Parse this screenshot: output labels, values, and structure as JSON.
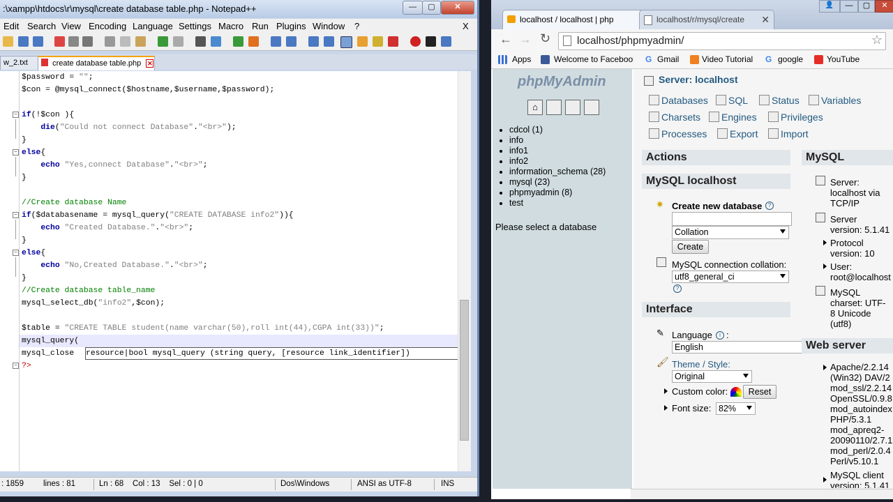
{
  "notepad": {
    "title": ":\\xampp\\htdocs\\r\\mysql\\create database table.php - Notepad++",
    "menu": [
      "Edit",
      "Search",
      "View",
      "Encoding",
      "Language",
      "Settings",
      "Macro",
      "Run",
      "Plugins",
      "Window",
      "?"
    ],
    "menu_close": "X",
    "tabs": [
      {
        "label": "w_2.txt"
      },
      {
        "label": "create database table.php"
      }
    ],
    "code_lines": [
      {
        "text": "$password = \"\";"
      },
      {
        "text": "$con = @mysql_connect($hostname,$username,$password);"
      },
      {
        "text": ""
      },
      {
        "text": "if(!$con ){"
      },
      {
        "text": "    die(\"Could not connect Database\".\"<br>\");"
      },
      {
        "text": "}"
      },
      {
        "text": "else{"
      },
      {
        "text": "    echo \"Yes,connect Database\".\"<br>\";"
      },
      {
        "text": "}"
      },
      {
        "text": ""
      },
      {
        "text": "//Create database Name"
      },
      {
        "text": "if($databasename = mysql_query(\"CREATE DATABASE info2\")){"
      },
      {
        "text": "    echo \"Created Database.\".\"<br>\";"
      },
      {
        "text": "}"
      },
      {
        "text": "else{"
      },
      {
        "text": "    echo \"No,Created Database.\".\"<br>\";"
      },
      {
        "text": "}"
      },
      {
        "text": "//Create database table_name"
      },
      {
        "text": "mysql_select_db(\"info2\",$con);"
      },
      {
        "text": ""
      },
      {
        "text": "$table = \"CREATE TABLE student(name varchar(50),roll int(44),CGPA int(33))\";"
      },
      {
        "text": "mysql_query("
      },
      {
        "text": "mysql_close"
      },
      {
        "text": "?>"
      }
    ],
    "calltip": "resource|bool mysql_query (string query, [resource link_identifier])",
    "status": {
      "length": ": 1859",
      "lines": "lines : 81",
      "position": "Ln : 68    Col : 13    Sel : 0 | 0",
      "eol": "Dos\\Windows",
      "encoding": "ANSI as UTF-8",
      "mode": "INS"
    }
  },
  "browser": {
    "tabs": [
      {
        "label": "localhost / localhost | php"
      },
      {
        "label": "localhost/r/mysql/create"
      }
    ],
    "url": "localhost/phpmyadmin/",
    "bookmarks": [
      "Apps",
      "Welcome to Facebook",
      "Gmail",
      "Video Tutorial",
      "google",
      "YouTube"
    ],
    "pma": {
      "logo": "phpMyAdmin",
      "databases": [
        {
          "name": "cdcol (1)"
        },
        {
          "name": "info"
        },
        {
          "name": "info1"
        },
        {
          "name": "info2"
        },
        {
          "name": "information_schema (28)"
        },
        {
          "name": "mysql (23)"
        },
        {
          "name": "phpmyadmin (8)"
        },
        {
          "name": "test"
        }
      ],
      "select_prompt": "Please select a database",
      "server_label": "Server: localhost",
      "top_nav": [
        "Databases",
        "SQL",
        "Status",
        "Variables",
        "Charsets",
        "Engines",
        "Privileges",
        "Processes",
        "Export",
        "Import"
      ],
      "actions_title": "Actions",
      "mysql_localhost_title": "MySQL localhost",
      "create_db_label": "Create new database",
      "collation_placeholder": "Collation",
      "create_button": "Create",
      "conn_collation_label": "MySQL connection collation:",
      "conn_collation_value": "utf8_general_ci",
      "interface_title": "Interface",
      "language_label": "Language",
      "language_value": "English",
      "theme_label": "Theme / Style:",
      "theme_value": "Original",
      "custom_color_label": "Custom color:",
      "reset_button": "Reset",
      "font_size_label": "Font size:",
      "font_size_value": "82%",
      "mysql_title": "MySQL",
      "mysql_info": [
        "Server:",
        "localhost via",
        "TCP/IP",
        "Server",
        "version: 5.1.41",
        "Protocol",
        "version: 10",
        "User:",
        "root@localhost",
        "MySQL",
        "charset: UTF-",
        "8 Unicode",
        "(utf8)"
      ],
      "webserver_title": "Web server",
      "webserver_info": [
        "Apache/2.2.14",
        "(Win32) DAV/2",
        "mod_ssl/2.2.14",
        "OpenSSL/0.9.8",
        "mod_autoindex",
        "PHP/5.3.1",
        "mod_apreq2-",
        "20090110/2.7.1",
        "mod_perl/2.0.4",
        "Perl/v5.10.1",
        "MySQL client",
        "version: 5.1.41"
      ]
    }
  }
}
